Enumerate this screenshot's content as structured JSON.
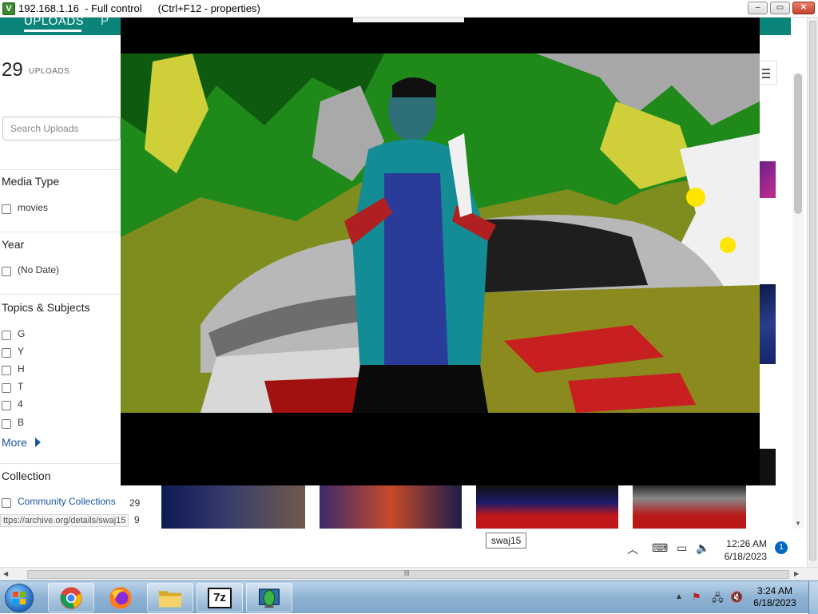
{
  "vnc": {
    "title": "192.168.1.16  - Full control",
    "title_extra": "(Ctrl+F12 - properties)",
    "min_label": "–",
    "max_label": "▭",
    "close_label": "✕"
  },
  "site": {
    "tab_uploads": "UPLOADS",
    "tab_next": "P",
    "uploads_count": "29",
    "uploads_label": "UPLOADS",
    "search_placeholder": "Search Uploads"
  },
  "facets": {
    "media_type": {
      "title": "Media Type",
      "items": [
        "movies"
      ]
    },
    "year": {
      "title": "Year",
      "items": [
        "(No Date)"
      ]
    },
    "topics": {
      "title": "Topics & Subjects",
      "items": [
        "G",
        "Y",
        "H",
        "T",
        "4",
        "B"
      ],
      "more": "More"
    },
    "collection": {
      "title": "Collection",
      "items": [
        {
          "label": "Community Collections",
          "count": "29"
        }
      ],
      "second_count": "9"
    }
  },
  "status_url": "ttps://archive.org/details/swaj15",
  "w11_taskbar": {
    "tooltip": "swaj15",
    "time": "12:26 AM",
    "date": "6/18/2023",
    "notif_count": "1",
    "icons": [
      "windows-start-icon",
      "search-icon",
      "file-explorer-icon",
      "firefox-icon",
      "chrome-icon",
      "media-player-icon"
    ]
  },
  "w7_taskbar": {
    "time": "3:24 AM",
    "date": "6/18/2023",
    "apps": [
      "chrome-icon",
      "firefox-icon",
      "explorer-icon",
      "7zip-icon",
      "vnc-viewer-icon"
    ],
    "app_7z_label": "7z"
  },
  "colors": {
    "site_header": "#0b8579",
    "link": "#1a55a2",
    "w11_accent": "#005fb8",
    "w7_taskbar": "#8fb3d4"
  }
}
